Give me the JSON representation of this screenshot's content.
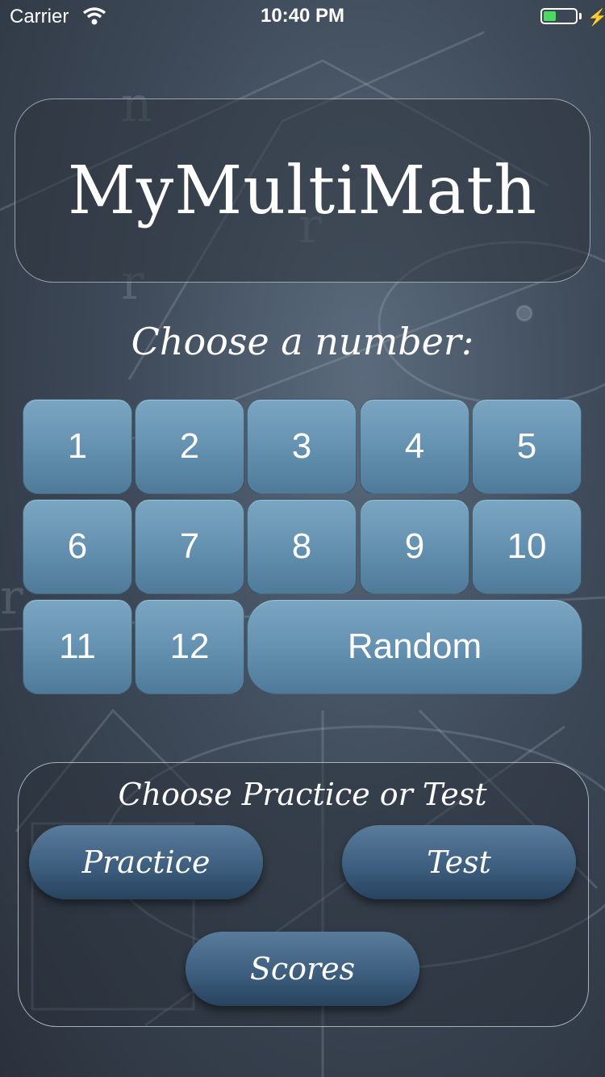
{
  "status_bar": {
    "carrier": "Carrier",
    "time": "10:40 PM",
    "battery_level": 0.4,
    "battery_color": "#4cd964"
  },
  "title": "MyMultiMath",
  "choose_number_label": "Choose a number:",
  "numbers": [
    "1",
    "2",
    "3",
    "4",
    "5",
    "6",
    "7",
    "8",
    "9",
    "10",
    "11",
    "12"
  ],
  "random_label": "Random",
  "mode_label": "Choose Practice or Test",
  "buttons": {
    "practice": "Practice",
    "test": "Test",
    "scores": "Scores"
  },
  "colors": {
    "number_button": "#6592b1",
    "pill_button": "#3e5f7f"
  }
}
